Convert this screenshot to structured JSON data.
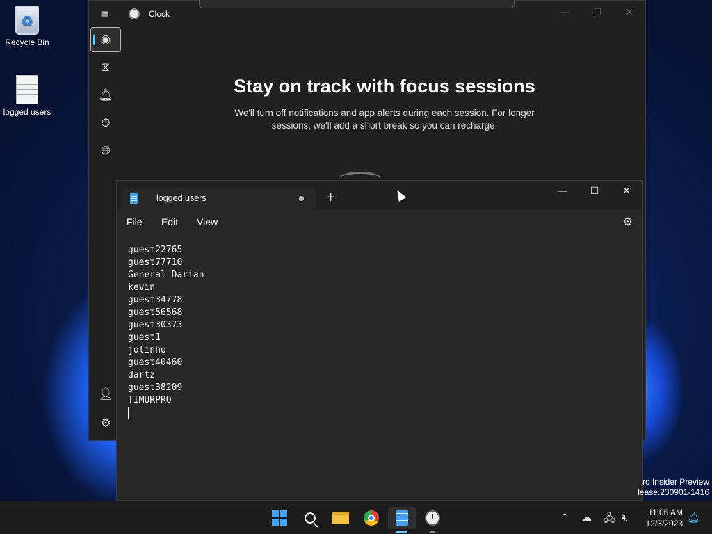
{
  "desktop": {
    "icons": [
      {
        "label": "Recycle Bin"
      },
      {
        "label": "logged users"
      }
    ],
    "watermark": {
      "line1": "ro Insider Preview",
      "line2": "lease.230901-1416"
    }
  },
  "clock_app": {
    "title": "Clock",
    "nav_icons": [
      "focus-sessions-icon",
      "timer-icon",
      "alarm-icon",
      "stopwatch-icon",
      "world-clock-icon"
    ],
    "heading": "Stay on track with focus sessions",
    "description": "We'll turn off notifications and app alerts during each session. For longer sessions, we'll add a short break so you can recharge."
  },
  "notepad": {
    "tab_title": "logged users",
    "unsaved": true,
    "menu": {
      "file": "File",
      "edit": "Edit",
      "view": "View"
    },
    "lines": [
      "guest22765",
      "guest77710",
      "General Darian",
      "kevin",
      "guest34778",
      "guest56568",
      "guest30373",
      "guest1",
      "jolinho",
      "guest40460",
      "dartz",
      "guest38209",
      "TIMURPRO"
    ]
  },
  "taskbar": {
    "apps": [
      "start",
      "search",
      "file-explorer",
      "chrome",
      "notepad",
      "clock"
    ],
    "time": "11:06 AM",
    "date": "12/3/2023"
  },
  "colors": {
    "accent": "#60cdff",
    "window_bg": "#202020",
    "editor_bg": "#272727"
  }
}
